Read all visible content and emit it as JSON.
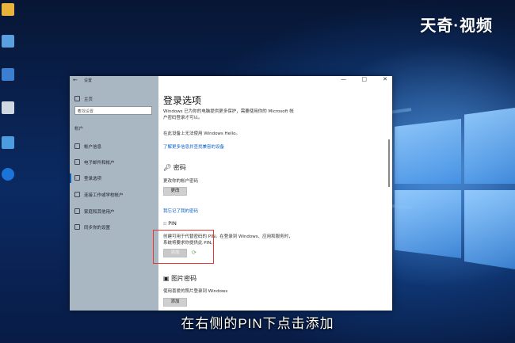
{
  "brand": "天奇·视频",
  "caption": "在右侧的PIN下点击添加",
  "window": {
    "back": "←",
    "title": "设置",
    "controls": [
      "—",
      "□",
      "✕"
    ]
  },
  "sidebar": {
    "home": "主页",
    "search_placeholder": "查找设置",
    "section": "帐户",
    "items": [
      {
        "label": "帐户信息",
        "icon": "user-icon"
      },
      {
        "label": "电子邮件和帐户",
        "icon": "mail-icon"
      },
      {
        "label": "登录选项",
        "icon": "key-icon",
        "active": true
      },
      {
        "label": "连接工作或学校帐户",
        "icon": "briefcase-icon"
      },
      {
        "label": "家庭和其他用户",
        "icon": "people-icon"
      },
      {
        "label": "同步你的设置",
        "icon": "sync-icon"
      }
    ]
  },
  "main": {
    "title": "登录选项",
    "intro": "Windows 已为你的电脑提供更多保护，需要使用你的 Microsoft 帐户密码登录才可以。",
    "hello_text": "在此设备上无法使用 Windows Hello。",
    "hello_link": "了解更多信息并查找兼容的设备",
    "password": {
      "heading": "密码",
      "desc": "更改你的帐户密码",
      "button": "更改"
    },
    "forgot_link": "我忘记了我的密码",
    "pin": {
      "heading": "PIN",
      "desc1": "创建可用于代替密码的 PIN。在登录到 Windows、应用和服务时，",
      "desc2": "系统将要求你提供此 PIN。",
      "button": "添加"
    },
    "picture_password": {
      "heading": "图片密码",
      "desc": "使用喜爱的照片登录到 Windows",
      "button": "添加"
    }
  }
}
